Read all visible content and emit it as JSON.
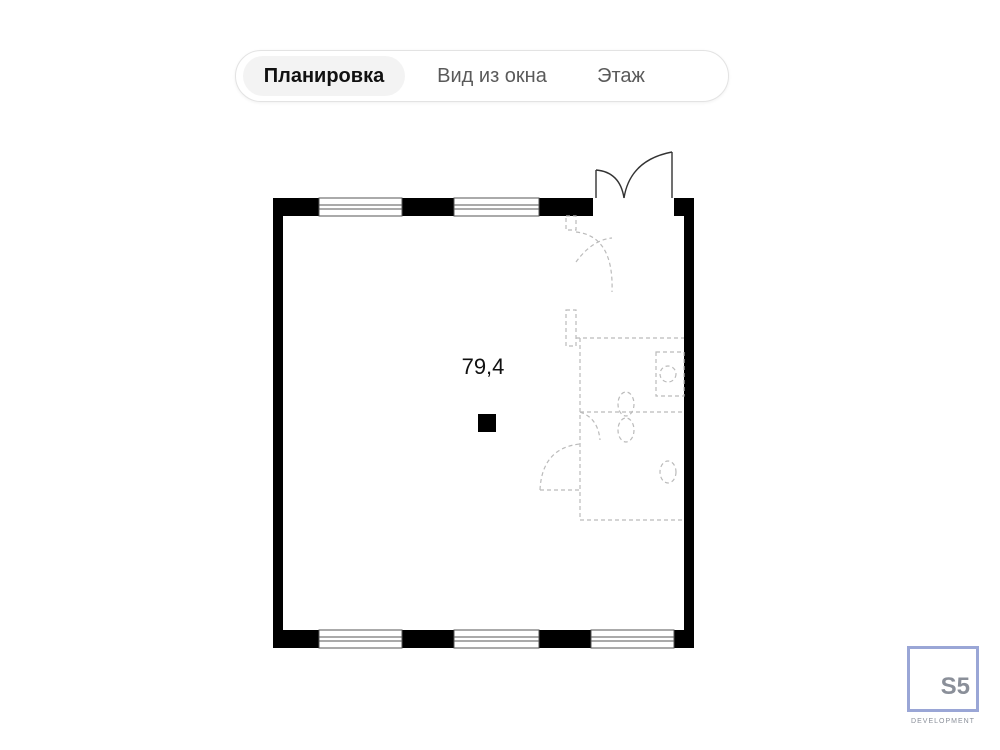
{
  "tabs": [
    {
      "label": "Планировка",
      "active": true
    },
    {
      "label": "Вид из окна",
      "active": false
    },
    {
      "label": "Этаж",
      "active": false
    }
  ],
  "plan": {
    "area": "79,4",
    "wall_color": "#000000",
    "fixture_color": "#bbbbbb"
  },
  "logo": {
    "mark": "S5",
    "subtitle": "DEVELOPMENT",
    "border_color": "#9aa6d6"
  }
}
